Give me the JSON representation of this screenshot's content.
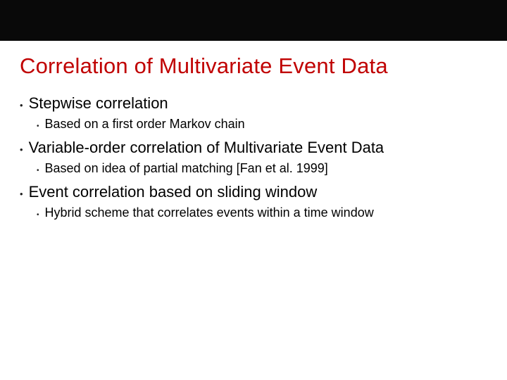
{
  "slide": {
    "title": "Correlation of Multivariate Event Data",
    "bullets": [
      {
        "text": "Stepwise correlation",
        "sub": {
          "text": "Based on a first order Markov chain"
        }
      },
      {
        "text": "Variable-order correlation of Multivariate Event Data",
        "sub": {
          "text": "Based on idea of partial matching [Fan et al. 1999]"
        }
      },
      {
        "text": "Event correlation based on sliding window",
        "sub": {
          "text": "Hybrid scheme that correlates events within a time window"
        }
      }
    ]
  }
}
